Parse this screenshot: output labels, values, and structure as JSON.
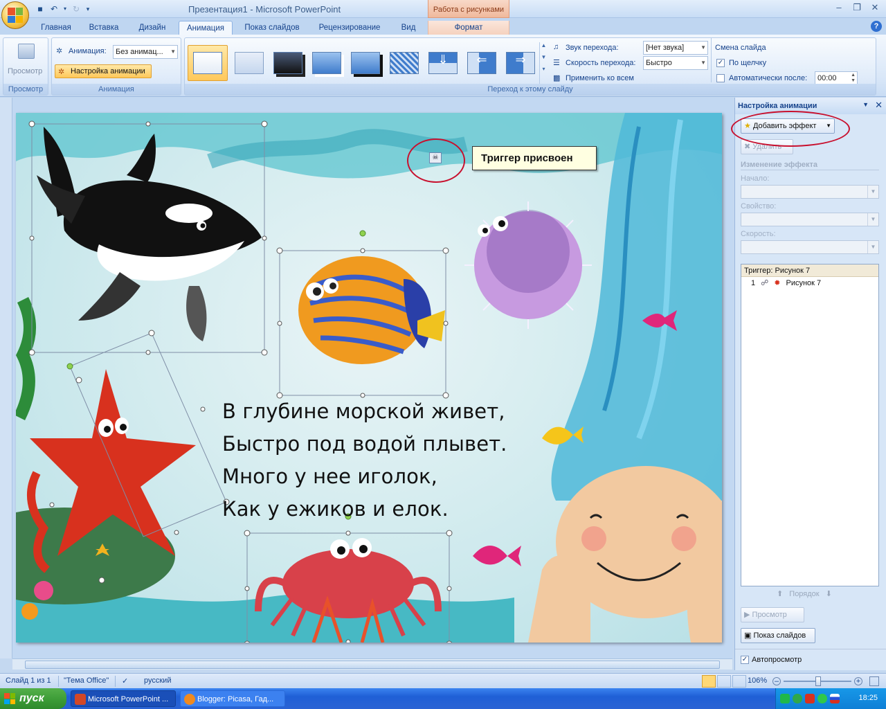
{
  "window": {
    "title": "Презентация1 - Microsoft PowerPoint",
    "contextual_header": "Работа с рисунками"
  },
  "tabs": [
    "Главная",
    "Вставка",
    "Дизайн",
    "Анимация",
    "Показ слайдов",
    "Рецензирование",
    "Вид",
    "Формат"
  ],
  "active_tab": "Анимация",
  "ribbon": {
    "preview_label": "Просмотр",
    "preview_group": "Просмотр",
    "animation_label": "Анимация:",
    "animation_value": "Без анимац...",
    "custom_animation_btn": "Настройка анимации",
    "animation_group": "Анимация",
    "transition_group": "Переход к этому слайду",
    "sound_label": "Звук перехода:",
    "sound_value": "[Нет звука]",
    "speed_label": "Скорость перехода:",
    "speed_value": "Быстро",
    "apply_all": "Применить ко всем",
    "advance_title": "Смена слайда",
    "on_click": "По щелчку",
    "on_click_checked": true,
    "auto_after": "Автоматически после:",
    "auto_after_checked": false,
    "auto_time": "00:00"
  },
  "slide": {
    "poem": [
      "В глубине морской живет,",
      "Быстро под водой плывет.",
      "Много у нее иголок,",
      "Как у ежиков и елок."
    ],
    "tooltip": "Триггер присвоен"
  },
  "taskpane": {
    "title": "Настройка анимации",
    "add_effect": "Добавить эффект",
    "remove": "Удалить",
    "change_effect": "Изменение эффекта",
    "start_label": "Начало:",
    "property_label": "Свойство:",
    "speed_label": "Скорость:",
    "trigger_header": "Триггер: Рисунок 7",
    "item_index": "1",
    "item_name": "Рисунок 7",
    "order_label": "Порядок",
    "play_btn": "Просмотр",
    "slideshow_btn": "Показ слайдов",
    "autopreview": "Автопросмотр",
    "autopreview_checked": true
  },
  "status": {
    "slide": "Слайд 1 из 1",
    "theme": "\"Тема Office\"",
    "language": "русский",
    "zoom": "106%"
  },
  "taskbar": {
    "start": "пуск",
    "items": [
      "Microsoft PowerPoint ...",
      "Blogger: Picasa, Гад..."
    ],
    "clock": "18:25"
  }
}
